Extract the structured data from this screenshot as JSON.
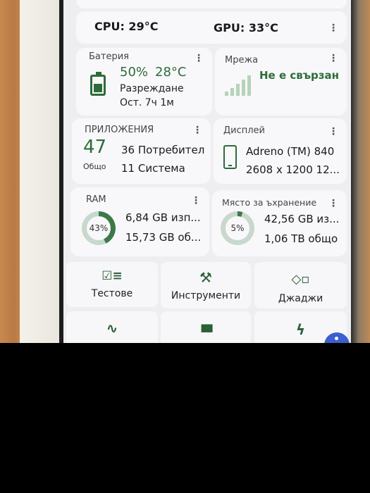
{
  "temps": {
    "cpu": "CPU: 29°C",
    "gpu": "GPU: 33°C"
  },
  "battery": {
    "title": "Батерия",
    "level": "50%",
    "temp": "28°C",
    "status": "Разреждане",
    "remaining": "Ост. 7ч 1м",
    "fill_percent": 50
  },
  "network": {
    "title": "Мрежа",
    "status": "Не е свързан"
  },
  "apps": {
    "title": "ПРИЛОЖЕНИЯ",
    "total": "47",
    "total_label": "Общо",
    "user": "36 Потребител",
    "system": "11 Система"
  },
  "display": {
    "title": "Дисплей",
    "gpu": "Adreno (TM) 840",
    "resolution": "2608 x 1200  12..."
  },
  "ram": {
    "title": "RAM",
    "percent": 43,
    "percent_label": "43%",
    "used": "6,84 GB изп...",
    "total": "15,73 GB об..."
  },
  "storage": {
    "title": "Място за ъхранение",
    "percent": 5,
    "percent_label": "5%",
    "used": "42,56 GB из...",
    "total": "1,06 TB общо"
  },
  "tiles": [
    {
      "icon": "checklist-icon",
      "glyph": "☑≡",
      "label": "Тестове"
    },
    {
      "icon": "tools-icon",
      "glyph": "⚒",
      "label": "Инструменти"
    },
    {
      "icon": "widgets-icon",
      "glyph": "◇▫",
      "label": "Джаджи"
    },
    {
      "icon": "pulse-icon",
      "glyph": "∿",
      "label": ""
    },
    {
      "icon": "bar-chart-icon",
      "glyph": "▮▮▮",
      "label": ""
    },
    {
      "icon": "bolt-icon",
      "glyph": "ϟ",
      "label": ""
    }
  ],
  "colors": {
    "accent": "#2e6b3a",
    "ring_track": "#c9d8cc",
    "ring_fill": "#3d7a48"
  }
}
